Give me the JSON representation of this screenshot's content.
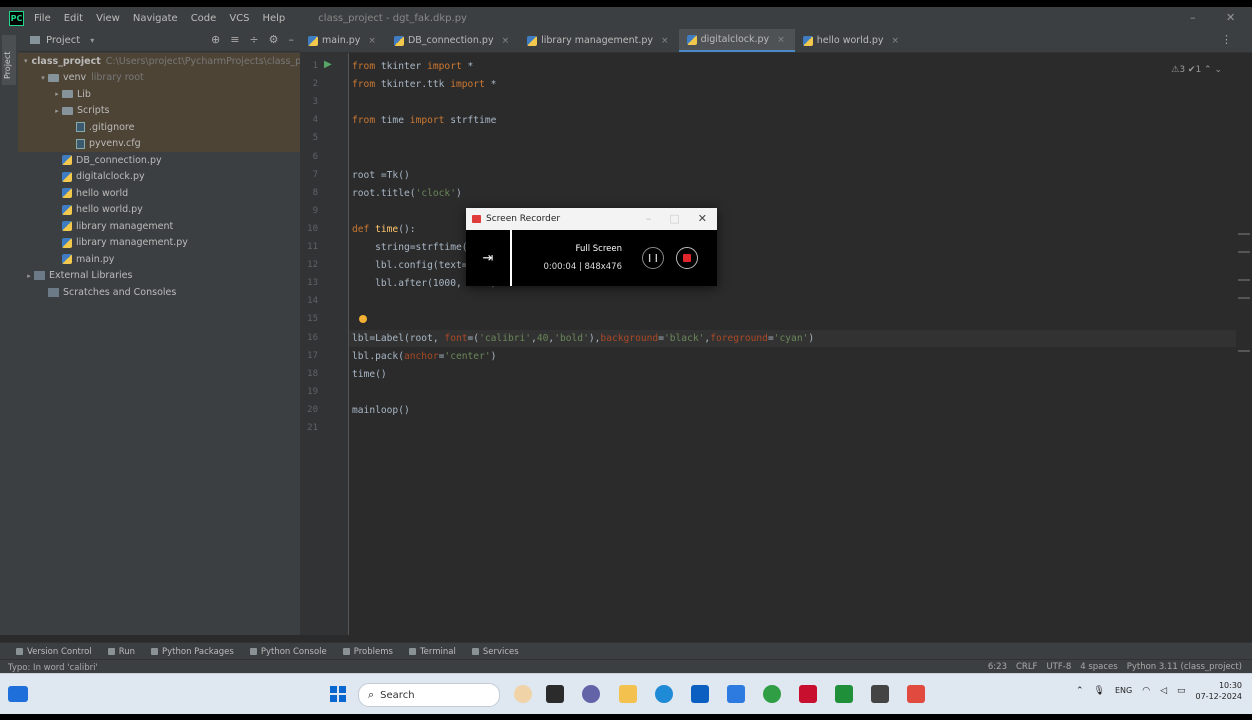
{
  "titlebar": {
    "menu": [
      "File",
      "Edit",
      "View",
      "Navigate",
      "Code",
      "VCS",
      "Help"
    ],
    "title": "class_project - dgt_fak.dkp.py"
  },
  "left_strip": {
    "project_tab": "Project"
  },
  "project_panel": {
    "title": "Project",
    "tree": [
      {
        "label": "class_project",
        "hint": "C:\\Users\\project\\PycharmProjects\\class_proj",
        "indent": 0,
        "icon": "folder",
        "arrow": "▾",
        "selected": true,
        "bold": true
      },
      {
        "label": "venv",
        "hint": "library root",
        "indent": 1,
        "icon": "folder",
        "arrow": "▾",
        "selected": true
      },
      {
        "label": "Lib",
        "hint": "",
        "indent": 2,
        "icon": "folder",
        "arrow": "▸",
        "selected": true
      },
      {
        "label": "Scripts",
        "hint": "",
        "indent": 2,
        "icon": "folder",
        "arrow": "▸",
        "selected": true
      },
      {
        "label": ".gitignore",
        "hint": "",
        "indent": 3,
        "icon": "file",
        "arrow": "",
        "selected": true
      },
      {
        "label": "pyvenv.cfg",
        "hint": "",
        "indent": 3,
        "icon": "file",
        "arrow": "",
        "selected": true
      },
      {
        "label": "DB_connection.py",
        "hint": "",
        "indent": 2,
        "icon": "py",
        "arrow": "",
        "selected": false
      },
      {
        "label": "digitalclock.py",
        "hint": "",
        "indent": 2,
        "icon": "py",
        "arrow": "",
        "selected": false
      },
      {
        "label": "hello world",
        "hint": "",
        "indent": 2,
        "icon": "py",
        "arrow": "",
        "selected": false
      },
      {
        "label": "hello world.py",
        "hint": "",
        "indent": 2,
        "icon": "py",
        "arrow": "",
        "selected": false
      },
      {
        "label": "library management",
        "hint": "",
        "indent": 2,
        "icon": "py",
        "arrow": "",
        "selected": false
      },
      {
        "label": "library management.py",
        "hint": "",
        "indent": 2,
        "icon": "py",
        "arrow": "",
        "selected": false
      },
      {
        "label": "main.py",
        "hint": "",
        "indent": 2,
        "icon": "py",
        "arrow": "",
        "selected": false
      },
      {
        "label": "External Libraries",
        "hint": "",
        "indent": 0,
        "icon": "lib",
        "arrow": "▸",
        "selected": false
      },
      {
        "label": "Scratches and Consoles",
        "hint": "",
        "indent": 1,
        "icon": "lib",
        "arrow": "",
        "selected": false
      }
    ]
  },
  "tabs": [
    {
      "label": "main.py",
      "active": false
    },
    {
      "label": "DB_connection.py",
      "active": false
    },
    {
      "label": "library management.py",
      "active": false
    },
    {
      "label": "digitalclock.py",
      "active": true
    },
    {
      "label": "hello world.py",
      "active": false
    }
  ],
  "editor": {
    "inspection": "⚠3 ✔1 ⌃ ⌄",
    "lines": [
      {
        "num": "1",
        "html": "<span class='kw'>from</span> tkinter <span class='kw'>import</span> *"
      },
      {
        "num": "2",
        "html": "<span class='kw'>from</span> tkinter.ttk <span class='kw'>import</span> *"
      },
      {
        "num": "3",
        "html": ""
      },
      {
        "num": "4",
        "html": "<span class='kw'>from</span> time <span class='kw'>import</span> strftime"
      },
      {
        "num": "5",
        "html": ""
      },
      {
        "num": "6",
        "html": ""
      },
      {
        "num": "7",
        "html": "root =Tk()"
      },
      {
        "num": "8",
        "html": "root.title(<span class='str'>'clock'</span>)"
      },
      {
        "num": "9",
        "html": ""
      },
      {
        "num": "10",
        "html": "<span class='kw'>def</span> <span class='fn'>time</span>():"
      },
      {
        "num": "11",
        "html": "    string=strftime(<span class='str'>'%H:%M:%S %p'</span>)"
      },
      {
        "num": "12",
        "html": "    lbl.config(text=string)"
      },
      {
        "num": "13",
        "html": "    lbl.after(1000, time)"
      },
      {
        "num": "14",
        "html": ""
      },
      {
        "num": "15",
        "html": ""
      },
      {
        "num": "16",
        "html": "lbl=Label(root, <span class='kwa'>font</span>=(<span class='str'>'calibri'</span>,<span class='str'>40</span>,<span class='str'>'bold'</span>),<span class='kwa'>background</span>=<span class='str'>'black'</span>,<span class='kwa'>foreground</span>=<span class='str'>'cyan'</span>)"
      },
      {
        "num": "17",
        "html": "lbl.pack(<span class='kwa'>anchor</span>=<span class='str'>'center'</span>)"
      },
      {
        "num": "18",
        "html": "time()"
      },
      {
        "num": "19",
        "html": ""
      },
      {
        "num": "20",
        "html": "mainloop()"
      },
      {
        "num": "21",
        "html": ""
      }
    ]
  },
  "recorder": {
    "title": "Screen Recorder",
    "mode": "Full Screen",
    "dims": "0:00:04 | 848x476"
  },
  "tool_windows": [
    "Version Control",
    "Run",
    "Python Packages",
    "Python Console",
    "Problems",
    "Terminal",
    "Services"
  ],
  "status": {
    "message": "Typo: In word 'calibri'",
    "items": [
      "6:23",
      "CRLF",
      "UTF-8",
      "4 spaces",
      "Python 3.11 (class_project)"
    ]
  },
  "taskbar": {
    "search": "Search",
    "clock_time": "10:30",
    "clock_date": "07-12-2024",
    "lang": "ENG"
  }
}
